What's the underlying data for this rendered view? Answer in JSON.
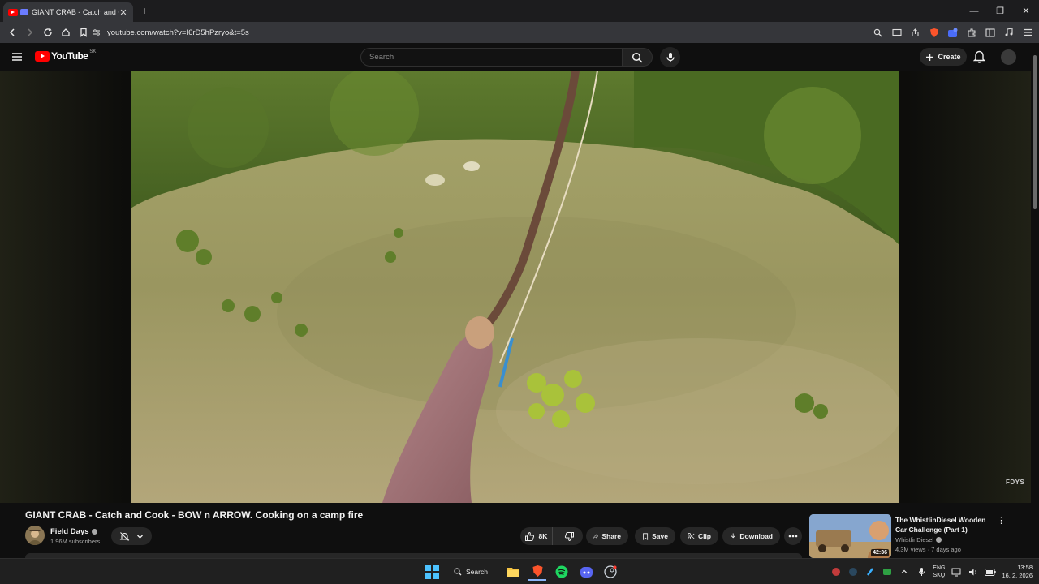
{
  "browser": {
    "tab_title": "GIANT CRAB - Catch and Cook - BOW n ARROW. Cooking on a camp fire",
    "url": "youtube.com/watch?v=I6rD5hPzryo&t=5s"
  },
  "youtube": {
    "logo_text": "YouTube",
    "country_code": "SK",
    "search_placeholder": "Search",
    "create_label": "Create"
  },
  "video": {
    "watermark": "FDYS",
    "title": "GIANT CRAB - Catch and Cook - BOW n ARROW. Cooking on a camp fire"
  },
  "channel": {
    "name": "Field Days",
    "subscribers": "1.96M subscribers"
  },
  "actions": {
    "likes": "8K",
    "share": "Share",
    "save": "Save",
    "clip": "Clip",
    "download": "Download"
  },
  "recommended": {
    "title": "The WhistlinDiesel Wooden Car Challenge (Part 1)",
    "channel": "WhistlinDiesel",
    "meta": "4.3M views · 7 days ago",
    "duration": "42:36"
  },
  "taskbar": {
    "search_label": "Search",
    "lang_top": "ENG",
    "lang_bottom": "SKQ",
    "time": "13:58",
    "date": "16. 2. 2026"
  }
}
